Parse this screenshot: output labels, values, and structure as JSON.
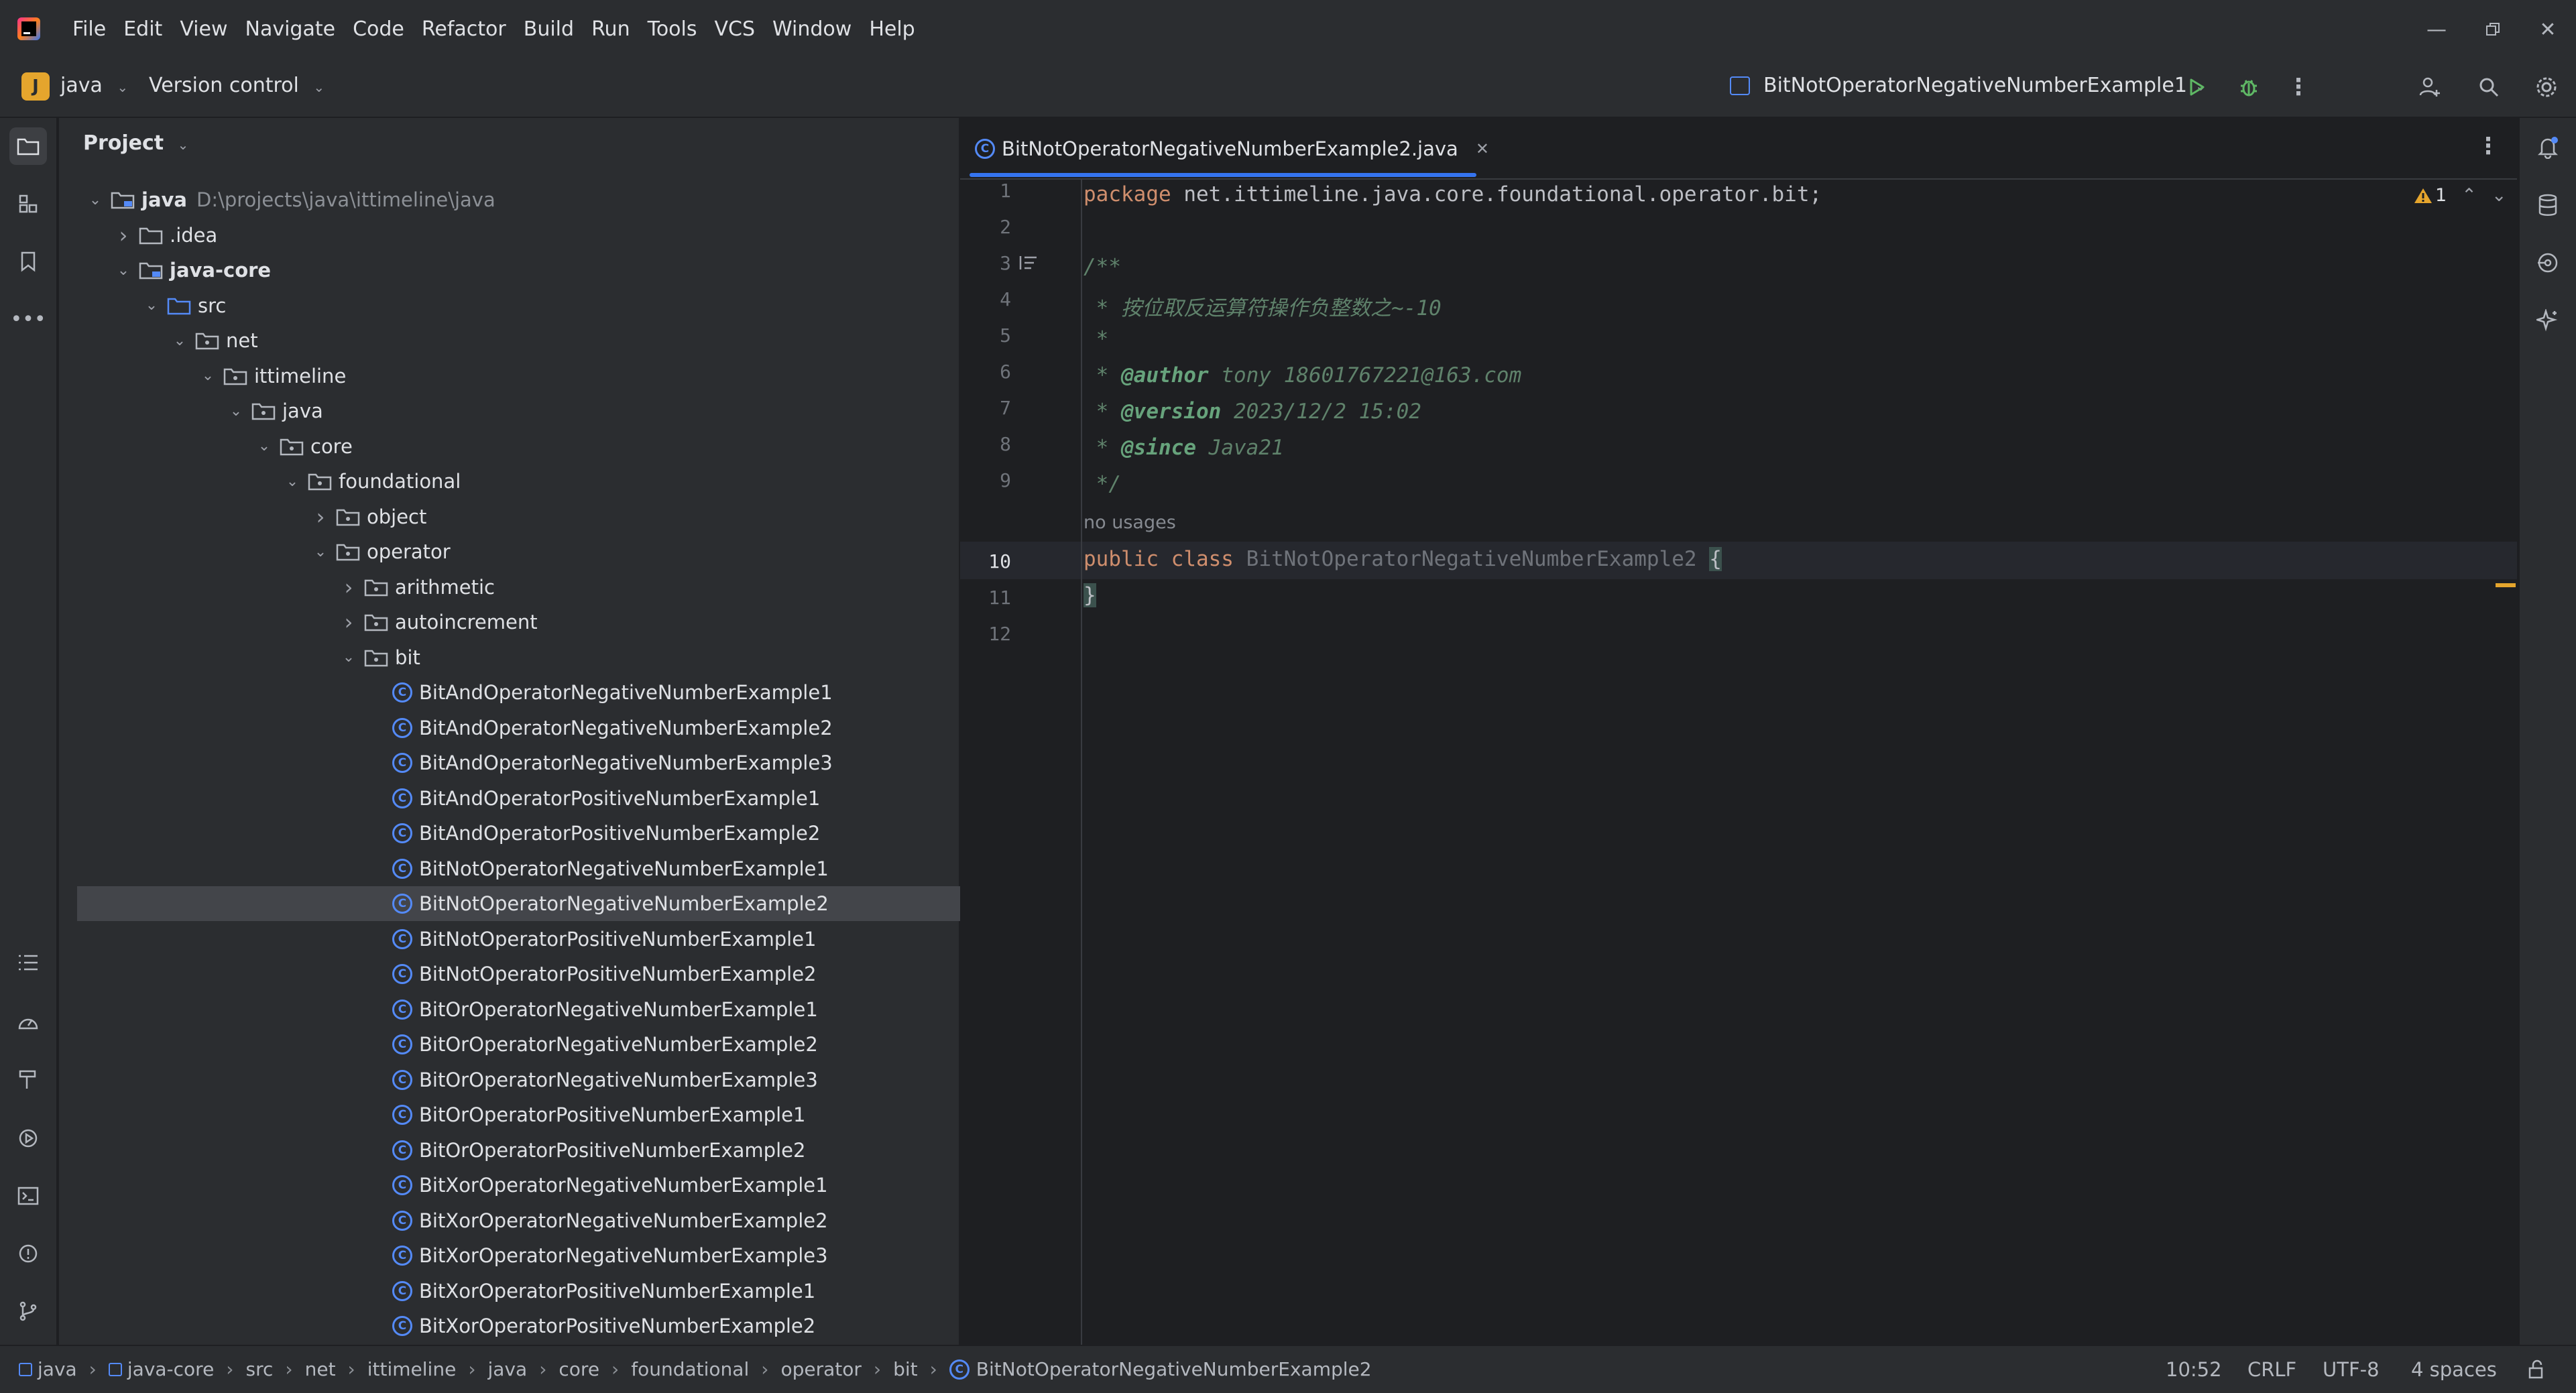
{
  "menu": [
    "File",
    "Edit",
    "View",
    "Navigate",
    "Code",
    "Refactor",
    "Build",
    "Run",
    "Tools",
    "VCS",
    "Window",
    "Help"
  ],
  "toolbar": {
    "project_badge": "J",
    "project_name": "java",
    "vcs_label": "Version control",
    "run_config": "BitNotOperatorNegativeNumberExample1"
  },
  "project_panel": {
    "title": "Project",
    "tree": [
      {
        "label": "java",
        "extra": "D:\\projects\\java\\ittimeline\\java",
        "kind": "module",
        "depth": 0,
        "expanded": true
      },
      {
        "label": ".idea",
        "kind": "folder",
        "depth": 1,
        "expanded": false
      },
      {
        "label": "java-core",
        "kind": "module",
        "depth": 1,
        "expanded": true
      },
      {
        "label": "src",
        "kind": "srcfolder",
        "depth": 2,
        "expanded": true
      },
      {
        "label": "net",
        "kind": "package",
        "depth": 3,
        "expanded": true
      },
      {
        "label": "ittimeline",
        "kind": "package",
        "depth": 4,
        "expanded": true
      },
      {
        "label": "java",
        "kind": "package",
        "depth": 5,
        "expanded": true
      },
      {
        "label": "core",
        "kind": "package",
        "depth": 6,
        "expanded": true
      },
      {
        "label": "foundational",
        "kind": "package",
        "depth": 7,
        "expanded": true
      },
      {
        "label": "object",
        "kind": "package",
        "depth": 8,
        "expanded": false
      },
      {
        "label": "operator",
        "kind": "package",
        "depth": 8,
        "expanded": true
      },
      {
        "label": "arithmetic",
        "kind": "package",
        "depth": 9,
        "expanded": false
      },
      {
        "label": "autoincrement",
        "kind": "package",
        "depth": 9,
        "expanded": false
      },
      {
        "label": "bit",
        "kind": "package",
        "depth": 9,
        "expanded": true
      },
      {
        "label": "BitAndOperatorNegativeNumberExample1",
        "kind": "class",
        "depth": 10
      },
      {
        "label": "BitAndOperatorNegativeNumberExample2",
        "kind": "class",
        "depth": 10
      },
      {
        "label": "BitAndOperatorNegativeNumberExample3",
        "kind": "class",
        "depth": 10
      },
      {
        "label": "BitAndOperatorPositiveNumberExample1",
        "kind": "class",
        "depth": 10
      },
      {
        "label": "BitAndOperatorPositiveNumberExample2",
        "kind": "class",
        "depth": 10
      },
      {
        "label": "BitNotOperatorNegativeNumberExample1",
        "kind": "class",
        "depth": 10
      },
      {
        "label": "BitNotOperatorNegativeNumberExample2",
        "kind": "class",
        "depth": 10,
        "selected": true
      },
      {
        "label": "BitNotOperatorPositiveNumberExample1",
        "kind": "class",
        "depth": 10
      },
      {
        "label": "BitNotOperatorPositiveNumberExample2",
        "kind": "class",
        "depth": 10
      },
      {
        "label": "BitOrOperatorNegativeNumberExample1",
        "kind": "class",
        "depth": 10
      },
      {
        "label": "BitOrOperatorNegativeNumberExample2",
        "kind": "class",
        "depth": 10
      },
      {
        "label": "BitOrOperatorNegativeNumberExample3",
        "kind": "class",
        "depth": 10
      },
      {
        "label": "BitOrOperatorPositiveNumberExample1",
        "kind": "class",
        "depth": 10
      },
      {
        "label": "BitOrOperatorPositiveNumberExample2",
        "kind": "class",
        "depth": 10
      },
      {
        "label": "BitXorOperatorNegativeNumberExample1",
        "kind": "class",
        "depth": 10
      },
      {
        "label": "BitXorOperatorNegativeNumberExample2",
        "kind": "class",
        "depth": 10
      },
      {
        "label": "BitXorOperatorNegativeNumberExample3",
        "kind": "class",
        "depth": 10
      },
      {
        "label": "BitXorOperatorPositiveNumberExample1",
        "kind": "class",
        "depth": 10
      },
      {
        "label": "BitXorOperatorPositiveNumberExample2",
        "kind": "class",
        "depth": 10
      }
    ]
  },
  "editor": {
    "tab_label": "BitNotOperatorNegativeNumberExample2.java",
    "warning_count": "1",
    "line_numbers": [
      "1",
      "2",
      "3",
      "4",
      "5",
      "6",
      "7",
      "8",
      "9",
      "10",
      "11",
      "12"
    ],
    "code": {
      "l1_kw": "package",
      "l1_rest": " net.ittimeline.java.core.foundational.operator.bit;",
      "l3": "/**",
      "l4": " * 按位取反运算符操作负整数之~-10",
      "l5": " *",
      "l6_star": " * ",
      "l6_tag": "@author",
      "l6_rest": " tony 18601767221@163.com",
      "l7_star": " * ",
      "l7_tag": "@version",
      "l7_rest": " 2023/12/2 15:02",
      "l8_star": " * ",
      "l8_tag": "@since",
      "l8_rest": " Java21",
      "l9": " */",
      "usages": "no usages",
      "l10_kw1": "public",
      "l10_kw2": "class",
      "l10_cls": "BitNotOperatorNegativeNumberExample2",
      "l10_brace": "{",
      "l11": "}"
    }
  },
  "statusbar": {
    "breadcrumbs": [
      "java",
      "java-core",
      "src",
      "net",
      "ittimeline",
      "java",
      "core",
      "foundational",
      "operator",
      "bit",
      "BitNotOperatorNegativeNumberExample2"
    ],
    "position": "10:52",
    "line_sep": "CRLF",
    "encoding": "UTF-8",
    "indent": "4 spaces"
  },
  "colors": {
    "accent": "#3574f0",
    "class_icon": "#548af7",
    "run_green": "#5fb865",
    "warning": "#e5a52d"
  }
}
